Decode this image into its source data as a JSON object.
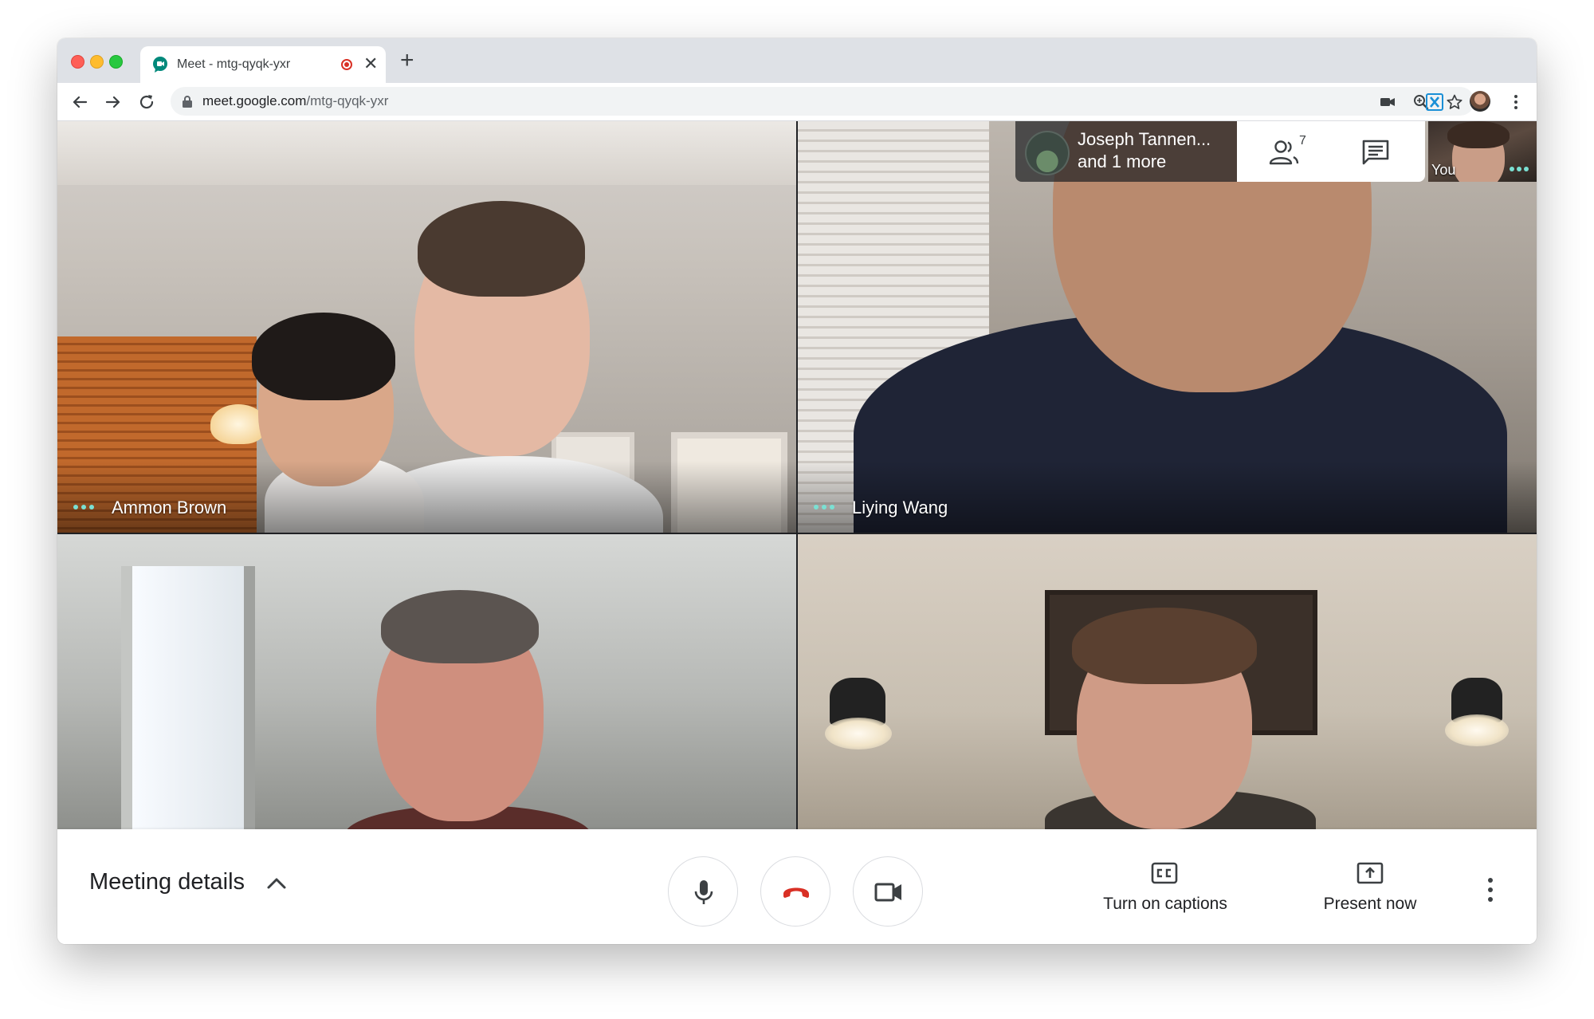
{
  "browser": {
    "tab_title": "Meet - mtg-qyqk-yxr",
    "close_glyph": "✕",
    "new_tab_glyph": "+",
    "url_host": "meet.google.com",
    "url_path": "/mtg-qyqk-yxr"
  },
  "participants": [
    {
      "name": "Ammon Brown",
      "speaking": true
    },
    {
      "name": "Liying Wang",
      "speaking": true
    },
    {
      "name": "",
      "speaking": false
    },
    {
      "name": "",
      "speaking": false
    }
  ],
  "others": {
    "line1": "Joseph Tannen...",
    "line2": "and 1 more"
  },
  "people_count": "7",
  "self_view": {
    "label": "You"
  },
  "controls": {
    "meeting_details": "Meeting details",
    "captions_label": "Turn on captions",
    "present_label": "Present now"
  },
  "colors": {
    "accent_dots": "#7ae0d3",
    "hangup_red": "#d93025",
    "meet_green": "#00897b"
  },
  "icons": [
    "back-icon",
    "forward-icon",
    "reload-icon",
    "lock-icon",
    "camera-icon",
    "zoom-icon",
    "star-icon",
    "extension-icon",
    "more-vert-icon",
    "people-icon",
    "chat-icon",
    "mic-icon",
    "hangup-icon",
    "video-icon",
    "captions-icon",
    "present-icon",
    "chevron-up-icon"
  ]
}
